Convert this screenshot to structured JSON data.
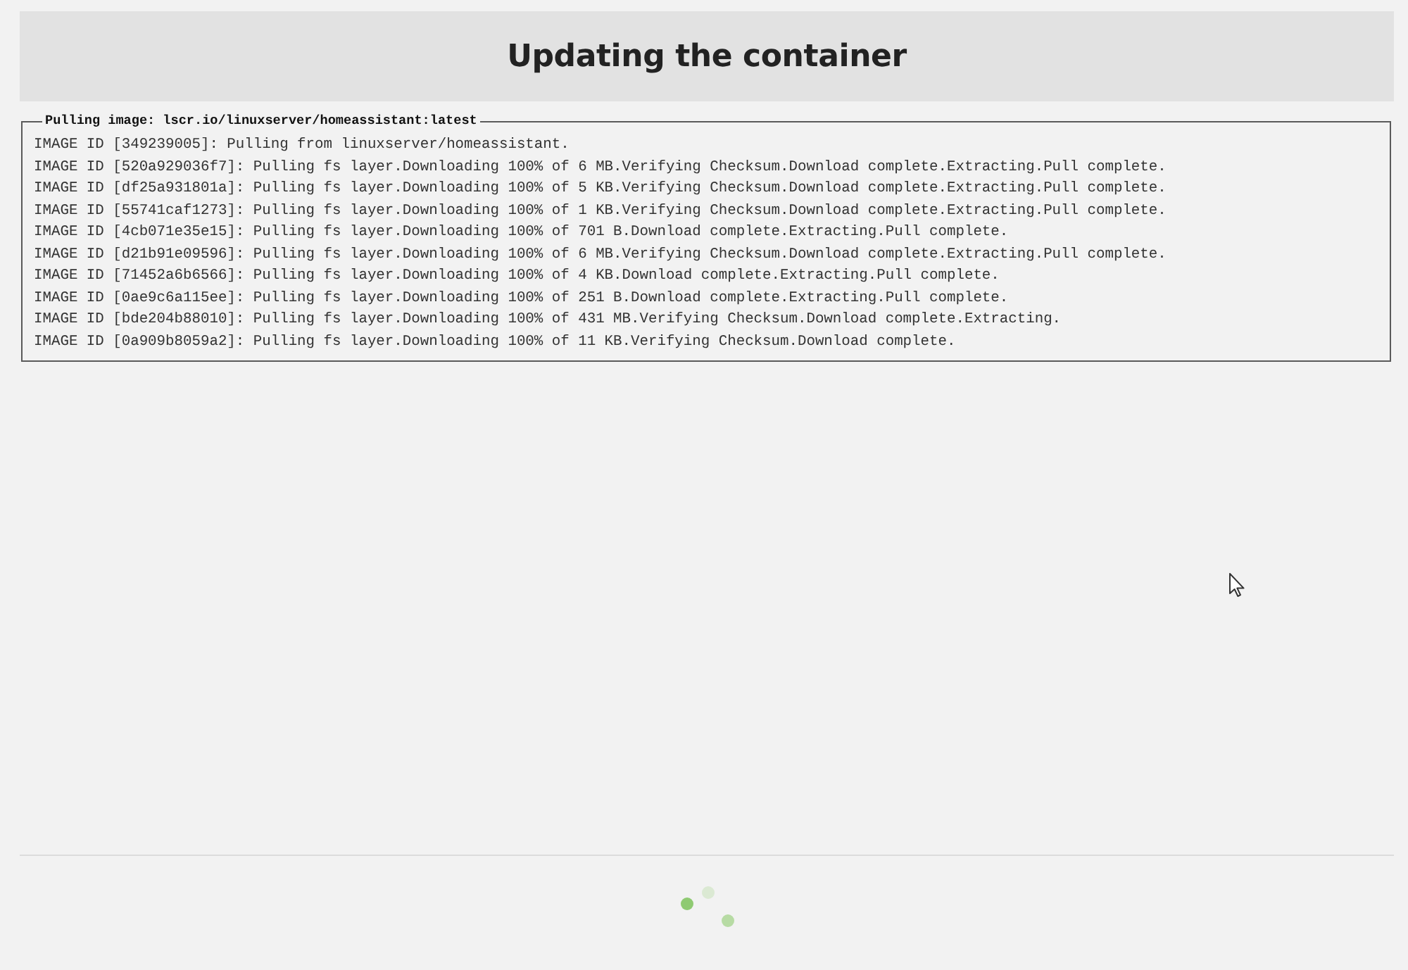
{
  "header": {
    "title": "Updating the container"
  },
  "log_panel": {
    "legend": "Pulling image: lscr.io/linuxserver/homeassistant:latest",
    "lines": [
      "IMAGE ID [349239005]: Pulling from linuxserver/homeassistant.",
      "IMAGE ID [520a929036f7]: Pulling fs layer.Downloading 100% of 6 MB.Verifying Checksum.Download complete.Extracting.Pull complete.",
      "IMAGE ID [df25a931801a]: Pulling fs layer.Downloading 100% of 5 KB.Verifying Checksum.Download complete.Extracting.Pull complete.",
      "IMAGE ID [55741caf1273]: Pulling fs layer.Downloading 100% of 1 KB.Verifying Checksum.Download complete.Extracting.Pull complete.",
      "IMAGE ID [4cb071e35e15]: Pulling fs layer.Downloading 100% of 701 B.Download complete.Extracting.Pull complete.",
      "IMAGE ID [d21b91e09596]: Pulling fs layer.Downloading 100% of 6 MB.Verifying Checksum.Download complete.Extracting.Pull complete.",
      "IMAGE ID [71452a6b6566]: Pulling fs layer.Downloading 100% of 4 KB.Download complete.Extracting.Pull complete.",
      "IMAGE ID [0ae9c6a115ee]: Pulling fs layer.Downloading 100% of 251 B.Download complete.Extracting.Pull complete.",
      "IMAGE ID [bde204b88010]: Pulling fs layer.Downloading 100% of 431 MB.Verifying Checksum.Download complete.Extracting.",
      "IMAGE ID [0a909b8059a2]: Pulling fs layer.Downloading 100% of 11 KB.Verifying Checksum.Download complete."
    ]
  }
}
